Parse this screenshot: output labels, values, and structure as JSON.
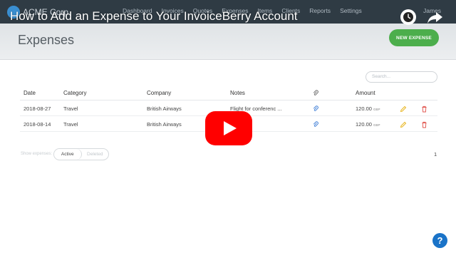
{
  "video": {
    "title": "How to Add an Expense to Your InvoiceBerry Account"
  },
  "app": {
    "brand": "ACME Corp",
    "nav": [
      "Dashboard",
      "Invoices",
      "Quotes",
      "Expenses",
      "Items",
      "Clients",
      "Reports",
      "Settings"
    ],
    "user": "James"
  },
  "page": {
    "title": "Expenses",
    "new_button": "NEW EXPENSE",
    "search_placeholder": "Search..."
  },
  "table": {
    "headers": {
      "date": "Date",
      "category": "Category",
      "company": "Company",
      "notes": "Notes",
      "amount": "Amount"
    },
    "rows": [
      {
        "date": "2018-08-27",
        "category": "Travel",
        "company": "British Airways",
        "notes": "Flight for conferenc ...",
        "amount": "120.00",
        "currency": "GBP"
      },
      {
        "date": "2018-08-14",
        "category": "Travel",
        "company": "British Airways",
        "notes": "",
        "amount": "120.00",
        "currency": "GBP"
      }
    ]
  },
  "filters": {
    "label": "Show expenses:",
    "active": "Active",
    "deleted": "Deleted",
    "page": "1"
  },
  "colors": {
    "primary_green": "#4cae4c",
    "play_red": "#ff0000",
    "help_blue": "#1a73c8"
  },
  "icons": [
    "clock-icon",
    "share-icon",
    "play-icon",
    "paperclip-icon",
    "pencil-icon",
    "trash-icon",
    "help-icon"
  ]
}
